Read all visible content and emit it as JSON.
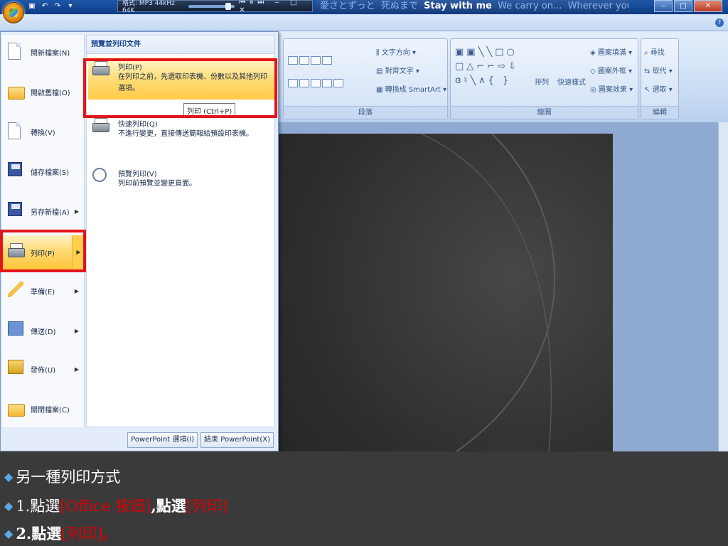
{
  "player": {
    "format": "格式: MP3 44kHz 64K"
  },
  "marquee": {
    "part1": "愛さとずっと",
    "part2": "死ぬまで",
    "part3": "Stay with me",
    "part4": "We carry on...",
    "part5": "Wherever you"
  },
  "ribbon": {
    "paragraph": {
      "label": "段落",
      "text_direction": "文字方向",
      "align_text": "對齊文字",
      "smartart": "轉換成 SmartArt"
    },
    "drawing": {
      "label": "繪圖",
      "arrange": "排列",
      "quick_styles": "快速樣式",
      "fill": "圖案填滿",
      "outline": "圖案外框",
      "effects": "圖案效果"
    },
    "editing": {
      "label": "編輯",
      "find": "尋找",
      "replace": "取代",
      "select": "選取"
    }
  },
  "office_menu": {
    "left_items": [
      {
        "label": "開新檔案(N)"
      },
      {
        "label": "開啟舊檔(O)"
      },
      {
        "label": "轉換(V)"
      },
      {
        "label": "儲存檔案(S)"
      },
      {
        "label": "另存新檔(A)"
      },
      {
        "label": "列印(P)"
      },
      {
        "label": "準備(E)"
      },
      {
        "label": "傳送(D)"
      },
      {
        "label": "發佈(U)"
      },
      {
        "label": "關閉檔案(C)"
      }
    ],
    "right_title": "預覽並列印文件",
    "right_items": [
      {
        "title": "列印(P)",
        "desc": "在列印之前，先選取印表機、份數以及其他列印選項。"
      },
      {
        "title": "快速列印(Q)",
        "desc": "不進行變更，直接傳送簡報給預設印表機。"
      },
      {
        "title": "預覽列印(V)",
        "desc": "列印前預覽並變更頁面。"
      }
    ],
    "tooltip": "列印 (Ctrl+P)",
    "options_button": "PowerPoint 選項(I)",
    "exit_button": "結束 PowerPoint(X)"
  },
  "caption": {
    "line1": "另一種列印方式",
    "line2_prefix": "1.點選",
    "line2_hl1": "[Office 按鈕]",
    "line2_mid": ",點選",
    "line2_hl2": "[列印]",
    "line3_prefix": "2.點選",
    "line3_hl": "[列印]",
    "line3_suffix": "。"
  },
  "colors": {
    "highlight_red": "#e3141b",
    "caption_red": "#e00000",
    "ribbon_blue": "#c4d9f2"
  }
}
